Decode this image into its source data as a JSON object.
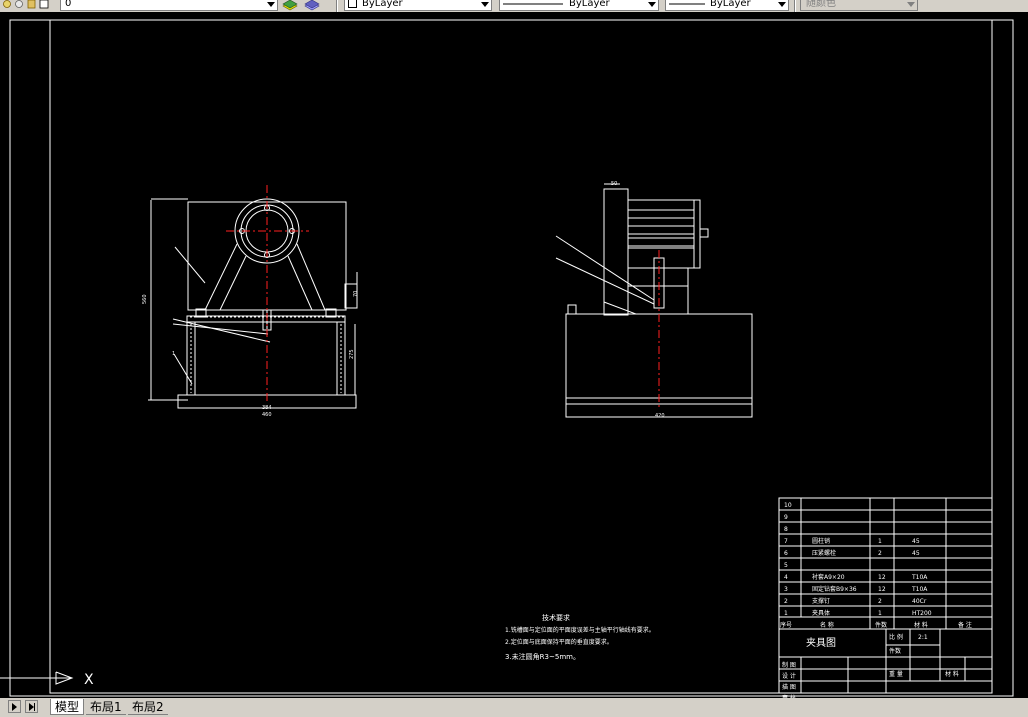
{
  "toolbar": {
    "layer_value": "0",
    "color_value": "ByLayer",
    "linetype_value": "ByLayer",
    "lineweight_value": "ByLayer",
    "plotstyle_value": "随颜色"
  },
  "tabs": [
    {
      "label": "模型",
      "active": true
    },
    {
      "label": "布局1",
      "active": false
    },
    {
      "label": "布局2",
      "active": false
    }
  ],
  "drawing": {
    "front_view": {
      "label_height": "560",
      "label_inner_width": "384",
      "label_outer_width": "460",
      "label_side_a": "70",
      "label_side_b": "275",
      "label_left": "1"
    },
    "side_view": {
      "label_top": "50",
      "label_base_width": "420"
    },
    "tech_notes": {
      "title": "技术要求",
      "line1": "1.铣槽面与定位面的平面度误差与主轴平行轴线有要求。",
      "line2": "2.定位面与底面保持平面的垂直度要求。",
      "line3": "3.未注圆角R3~5mm。"
    },
    "title_block": {
      "rows": [
        {
          "no": "10",
          "name": "",
          "qty": "",
          "material": "",
          "note": ""
        },
        {
          "no": "9",
          "name": "",
          "qty": "",
          "material": "",
          "note": ""
        },
        {
          "no": "8",
          "name": "",
          "qty": "",
          "material": "",
          "note": ""
        },
        {
          "no": "7",
          "name": "圆柱销",
          "qty": "1",
          "material": "45",
          "note": ""
        },
        {
          "no": "6",
          "name": "压紧螺栓",
          "qty": "2",
          "material": "45",
          "note": ""
        },
        {
          "no": "5",
          "name": "",
          "qty": "",
          "material": "",
          "note": ""
        },
        {
          "no": "4",
          "name": "衬套A9×20",
          "qty": "12",
          "material": "T10A",
          "note": ""
        },
        {
          "no": "3",
          "name": "固定钻套B9×36",
          "qty": "12",
          "material": "T10A",
          "note": ""
        },
        {
          "no": "2",
          "name": "支撑钉",
          "qty": "2",
          "material": "40Cr",
          "note": ""
        },
        {
          "no": "1",
          "name": "夹具体",
          "qty": "1",
          "material": "HT200",
          "note": ""
        }
      ],
      "header": {
        "no": "序号",
        "name": "名 称",
        "qty": "件数",
        "material": "材 料",
        "note": "备 注"
      },
      "drawing_name": "夹具图",
      "scale_label": "比 例",
      "scale_value": "2:1",
      "count_label": "件数",
      "weight_label": "重 量",
      "material_label": "材 料",
      "drawn_label": "制 图",
      "designed_label": "设 计",
      "check_label": "描 图",
      "review_label": "审 核"
    }
  },
  "ucs": {
    "x_label": "X"
  }
}
